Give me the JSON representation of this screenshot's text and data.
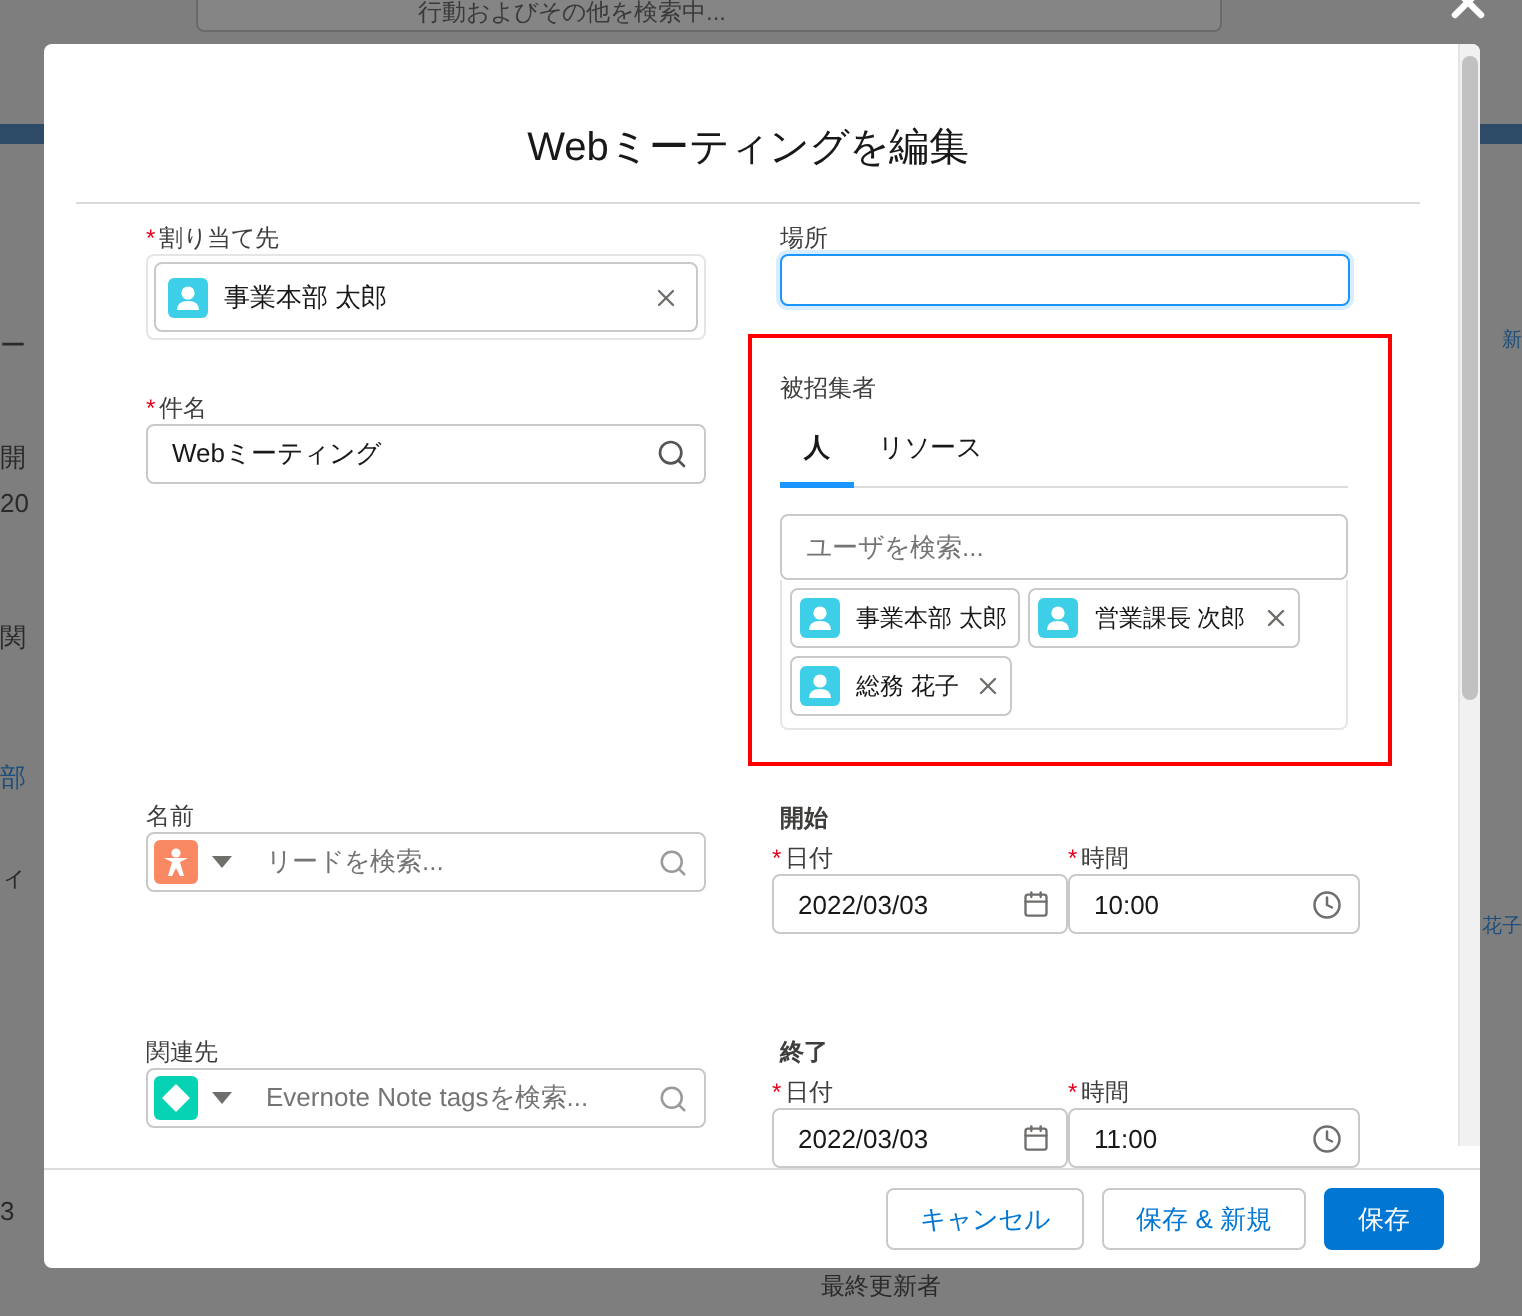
{
  "background": {
    "search_placeholder": "行動およびその他を検索中...",
    "left_fragments": [
      "ー",
      "開",
      "20",
      "関",
      "部",
      "ィ",
      "3"
    ],
    "right_fragments": [
      "新",
      "花子"
    ],
    "bottom_label": "最終更新者"
  },
  "dialog": {
    "title": "Webミーティングを編集",
    "assigned_to": {
      "label": "割り当て先",
      "required_mark": "*",
      "value": "事業本部 太郎"
    },
    "subject": {
      "label": "件名",
      "required_mark": "*",
      "value": "Webミーティング"
    },
    "name": {
      "label": "名前",
      "placeholder": "リードを検索...",
      "kind": "lead"
    },
    "related_to": {
      "label": "関連先",
      "placeholder": "Evernote Note tagsを検索...",
      "kind": "record"
    },
    "location": {
      "label": "場所",
      "focused": true
    },
    "invitees": {
      "label": "被招集者",
      "highlighted": true,
      "tabs": [
        {
          "label": "人",
          "selected": true
        },
        {
          "label": "リソース",
          "selected": false
        }
      ],
      "search_placeholder": "ユーザを検索...",
      "chips": [
        {
          "name": "事業本部 太郎",
          "removable": false
        },
        {
          "name": "営業課長 次郎",
          "removable": true
        },
        {
          "name": "総務 花子",
          "removable": true
        }
      ]
    },
    "start": {
      "heading": "開始",
      "date_label": "日付",
      "time_label": "時間",
      "required_mark": "*",
      "date": "2022/03/03",
      "time": "10:00"
    },
    "end": {
      "heading": "終了",
      "date_label": "日付",
      "time_label": "時間",
      "required_mark": "*",
      "date": "2022/03/03",
      "time": "11:00"
    },
    "buttons": [
      {
        "label": "キャンセル",
        "kind": "neutral"
      },
      {
        "label": "保存 & 新規",
        "kind": "neutral"
      },
      {
        "label": "保存",
        "kind": "brand"
      }
    ]
  }
}
